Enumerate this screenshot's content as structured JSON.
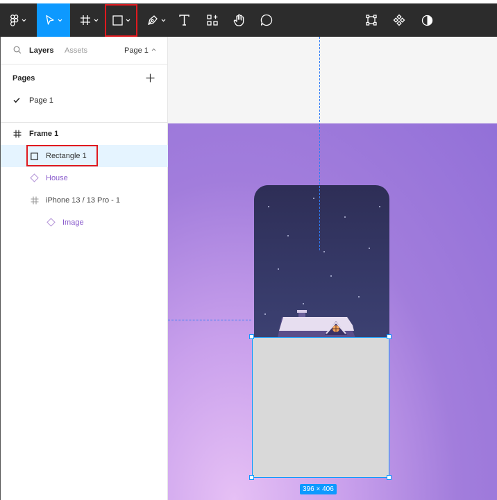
{
  "toolbar": {
    "tools": [
      {
        "name": "main-menu",
        "icon": "figma-logo-icon",
        "has_dropdown": true
      },
      {
        "name": "move",
        "icon": "cursor-arrow-icon",
        "has_dropdown": true,
        "active": true
      },
      {
        "name": "frame",
        "icon": "frame-hash-icon",
        "has_dropdown": true
      },
      {
        "name": "shape",
        "icon": "rectangle-icon",
        "has_dropdown": true,
        "highlighted": true
      },
      {
        "name": "pen",
        "icon": "pen-icon",
        "has_dropdown": true
      },
      {
        "name": "text",
        "icon": "text-icon"
      },
      {
        "name": "resources",
        "icon": "resources-icon"
      },
      {
        "name": "hand",
        "icon": "hand-icon"
      },
      {
        "name": "comment",
        "icon": "comment-icon"
      },
      {
        "name": "transform",
        "icon": "transform-icon"
      },
      {
        "name": "components",
        "icon": "components-icon"
      },
      {
        "name": "contrast",
        "icon": "contrast-icon"
      }
    ],
    "active_color": "#0d99ff",
    "highlight_color": "#e0191f"
  },
  "panel": {
    "tabs": {
      "layers": "Layers",
      "assets": "Assets",
      "page_selector": "Page 1"
    },
    "pages": {
      "title": "Pages",
      "items": [
        {
          "label": "Page 1",
          "current": true
        }
      ]
    },
    "layers": [
      {
        "label": "Frame 1",
        "type": "frame",
        "depth": 0
      },
      {
        "label": "Rectangle 1",
        "type": "rectangle",
        "depth": 1,
        "selected": true
      },
      {
        "label": "House",
        "type": "component",
        "depth": 1
      },
      {
        "label": "iPhone 13 / 13 Pro - 1",
        "type": "frame",
        "depth": 1
      },
      {
        "label": "Image",
        "type": "component",
        "depth": 2
      }
    ]
  },
  "canvas": {
    "selection_size_label": "396 × 406",
    "frame_gradient_colors": [
      "#e6c0f5",
      "#9270d8"
    ],
    "rectangle_fill": "#d9d9d9",
    "selection_color": "#0d99ff"
  }
}
